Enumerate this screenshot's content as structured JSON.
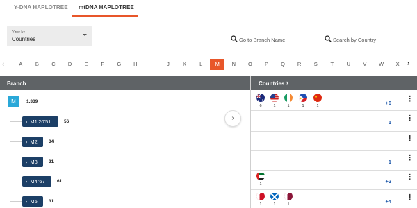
{
  "tabs": [
    {
      "label": "Y-DNA HAPLOTREE",
      "active": false
    },
    {
      "label": "mtDNA HAPLOTREE",
      "active": true
    }
  ],
  "accent_color": "#e8562a",
  "view_by": {
    "label": "View by",
    "value": "Countries"
  },
  "branch_search": {
    "placeholder": "Go to Branch Name",
    "icon": "search-icon"
  },
  "country_search": {
    "placeholder": "Search by Country",
    "icon": "search-icon"
  },
  "alphabet": {
    "letters": [
      "A",
      "B",
      "C",
      "D",
      "E",
      "F",
      "G",
      "H",
      "I",
      "J",
      "K",
      "L",
      "M",
      "N",
      "O",
      "P",
      "Q",
      "R",
      "S",
      "T",
      "U",
      "V",
      "W",
      "X"
    ],
    "selected": "M",
    "prev_icon": "chevron-left-icon",
    "next_icon": "chevron-right-icon"
  },
  "table_header": {
    "branch": "Branch",
    "countries": "Countries",
    "countries_icon": "chevron-right-icon"
  },
  "root": {
    "label": "M",
    "count": "1,339"
  },
  "branches": [
    {
      "label": "M1'20'51",
      "count": "56"
    },
    {
      "label": "M2",
      "count": "34"
    },
    {
      "label": "M3",
      "count": "21"
    },
    {
      "label": "M4\"67",
      "count": "61"
    },
    {
      "label": "M5",
      "count": "31"
    }
  ],
  "country_rows": [
    {
      "flags": [
        {
          "name": "australia",
          "count": "6"
        },
        {
          "name": "usa",
          "count": "1"
        },
        {
          "name": "ireland",
          "count": "1"
        },
        {
          "name": "philippines",
          "count": "1"
        },
        {
          "name": "china",
          "count": "1"
        }
      ],
      "more": "+6"
    },
    {
      "flags": [],
      "more": "1"
    },
    {
      "flags": [],
      "more": ""
    },
    {
      "flags": [],
      "more": "1"
    },
    {
      "flags": [
        {
          "name": "uae",
          "count": "1"
        }
      ],
      "more": "+2"
    },
    {
      "flags": [
        {
          "name": "bahrain",
          "count": "1"
        },
        {
          "name": "scotland",
          "count": "1"
        },
        {
          "name": "qatar",
          "count": "1"
        }
      ],
      "more": "+4"
    }
  ]
}
